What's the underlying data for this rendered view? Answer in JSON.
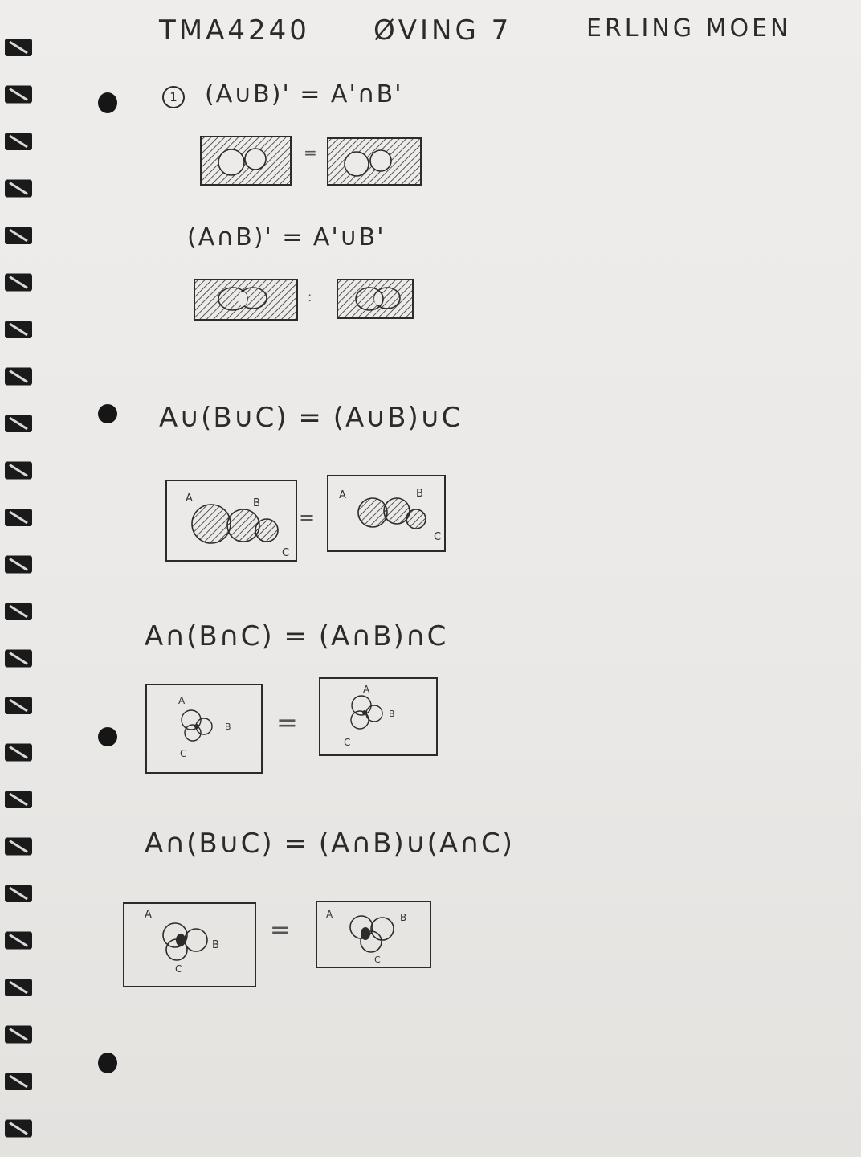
{
  "header": {
    "course": "TMA4240",
    "assignment": "ØVING 7",
    "author": "ERLING MOEN"
  },
  "item_number": "1",
  "laws": [
    {
      "lhs": "(A∪B)'",
      "rhs": "A'∩B'",
      "text": "(A∪B)' = A'∩B'"
    },
    {
      "text": "(A∩B)' = A'∪B'"
    },
    {
      "text": "A∪(B∪C) = (A∪B)∪C"
    },
    {
      "text": "A∩(B∩C) = (A∩B)∩C"
    },
    {
      "text": "A∩(B∪C) = (A∩B)∪(A∩C)"
    }
  ],
  "venn_labels": {
    "a": "A",
    "b": "B",
    "c": "C"
  },
  "equals": "=",
  "colors": {
    "ink": "#2b2b2b",
    "paper": "#ecebe9",
    "hole": "#161616"
  }
}
